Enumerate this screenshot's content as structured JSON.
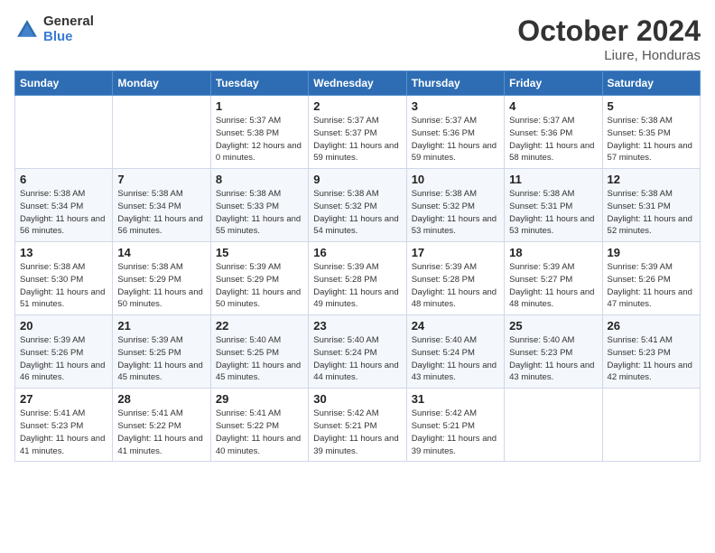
{
  "logo": {
    "general": "General",
    "blue": "Blue"
  },
  "title": "October 2024",
  "location": "Liure, Honduras",
  "headers": [
    "Sunday",
    "Monday",
    "Tuesday",
    "Wednesday",
    "Thursday",
    "Friday",
    "Saturday"
  ],
  "weeks": [
    [
      {
        "day": "",
        "sunrise": "",
        "sunset": "",
        "daylight": ""
      },
      {
        "day": "",
        "sunrise": "",
        "sunset": "",
        "daylight": ""
      },
      {
        "day": "1",
        "sunrise": "Sunrise: 5:37 AM",
        "sunset": "Sunset: 5:38 PM",
        "daylight": "Daylight: 12 hours and 0 minutes."
      },
      {
        "day": "2",
        "sunrise": "Sunrise: 5:37 AM",
        "sunset": "Sunset: 5:37 PM",
        "daylight": "Daylight: 11 hours and 59 minutes."
      },
      {
        "day": "3",
        "sunrise": "Sunrise: 5:37 AM",
        "sunset": "Sunset: 5:36 PM",
        "daylight": "Daylight: 11 hours and 59 minutes."
      },
      {
        "day": "4",
        "sunrise": "Sunrise: 5:37 AM",
        "sunset": "Sunset: 5:36 PM",
        "daylight": "Daylight: 11 hours and 58 minutes."
      },
      {
        "day": "5",
        "sunrise": "Sunrise: 5:38 AM",
        "sunset": "Sunset: 5:35 PM",
        "daylight": "Daylight: 11 hours and 57 minutes."
      }
    ],
    [
      {
        "day": "6",
        "sunrise": "Sunrise: 5:38 AM",
        "sunset": "Sunset: 5:34 PM",
        "daylight": "Daylight: 11 hours and 56 minutes."
      },
      {
        "day": "7",
        "sunrise": "Sunrise: 5:38 AM",
        "sunset": "Sunset: 5:34 PM",
        "daylight": "Daylight: 11 hours and 56 minutes."
      },
      {
        "day": "8",
        "sunrise": "Sunrise: 5:38 AM",
        "sunset": "Sunset: 5:33 PM",
        "daylight": "Daylight: 11 hours and 55 minutes."
      },
      {
        "day": "9",
        "sunrise": "Sunrise: 5:38 AM",
        "sunset": "Sunset: 5:32 PM",
        "daylight": "Daylight: 11 hours and 54 minutes."
      },
      {
        "day": "10",
        "sunrise": "Sunrise: 5:38 AM",
        "sunset": "Sunset: 5:32 PM",
        "daylight": "Daylight: 11 hours and 53 minutes."
      },
      {
        "day": "11",
        "sunrise": "Sunrise: 5:38 AM",
        "sunset": "Sunset: 5:31 PM",
        "daylight": "Daylight: 11 hours and 53 minutes."
      },
      {
        "day": "12",
        "sunrise": "Sunrise: 5:38 AM",
        "sunset": "Sunset: 5:31 PM",
        "daylight": "Daylight: 11 hours and 52 minutes."
      }
    ],
    [
      {
        "day": "13",
        "sunrise": "Sunrise: 5:38 AM",
        "sunset": "Sunset: 5:30 PM",
        "daylight": "Daylight: 11 hours and 51 minutes."
      },
      {
        "day": "14",
        "sunrise": "Sunrise: 5:38 AM",
        "sunset": "Sunset: 5:29 PM",
        "daylight": "Daylight: 11 hours and 50 minutes."
      },
      {
        "day": "15",
        "sunrise": "Sunrise: 5:39 AM",
        "sunset": "Sunset: 5:29 PM",
        "daylight": "Daylight: 11 hours and 50 minutes."
      },
      {
        "day": "16",
        "sunrise": "Sunrise: 5:39 AM",
        "sunset": "Sunset: 5:28 PM",
        "daylight": "Daylight: 11 hours and 49 minutes."
      },
      {
        "day": "17",
        "sunrise": "Sunrise: 5:39 AM",
        "sunset": "Sunset: 5:28 PM",
        "daylight": "Daylight: 11 hours and 48 minutes."
      },
      {
        "day": "18",
        "sunrise": "Sunrise: 5:39 AM",
        "sunset": "Sunset: 5:27 PM",
        "daylight": "Daylight: 11 hours and 48 minutes."
      },
      {
        "day": "19",
        "sunrise": "Sunrise: 5:39 AM",
        "sunset": "Sunset: 5:26 PM",
        "daylight": "Daylight: 11 hours and 47 minutes."
      }
    ],
    [
      {
        "day": "20",
        "sunrise": "Sunrise: 5:39 AM",
        "sunset": "Sunset: 5:26 PM",
        "daylight": "Daylight: 11 hours and 46 minutes."
      },
      {
        "day": "21",
        "sunrise": "Sunrise: 5:39 AM",
        "sunset": "Sunset: 5:25 PM",
        "daylight": "Daylight: 11 hours and 45 minutes."
      },
      {
        "day": "22",
        "sunrise": "Sunrise: 5:40 AM",
        "sunset": "Sunset: 5:25 PM",
        "daylight": "Daylight: 11 hours and 45 minutes."
      },
      {
        "day": "23",
        "sunrise": "Sunrise: 5:40 AM",
        "sunset": "Sunset: 5:24 PM",
        "daylight": "Daylight: 11 hours and 44 minutes."
      },
      {
        "day": "24",
        "sunrise": "Sunrise: 5:40 AM",
        "sunset": "Sunset: 5:24 PM",
        "daylight": "Daylight: 11 hours and 43 minutes."
      },
      {
        "day": "25",
        "sunrise": "Sunrise: 5:40 AM",
        "sunset": "Sunset: 5:23 PM",
        "daylight": "Daylight: 11 hours and 43 minutes."
      },
      {
        "day": "26",
        "sunrise": "Sunrise: 5:41 AM",
        "sunset": "Sunset: 5:23 PM",
        "daylight": "Daylight: 11 hours and 42 minutes."
      }
    ],
    [
      {
        "day": "27",
        "sunrise": "Sunrise: 5:41 AM",
        "sunset": "Sunset: 5:23 PM",
        "daylight": "Daylight: 11 hours and 41 minutes."
      },
      {
        "day": "28",
        "sunrise": "Sunrise: 5:41 AM",
        "sunset": "Sunset: 5:22 PM",
        "daylight": "Daylight: 11 hours and 41 minutes."
      },
      {
        "day": "29",
        "sunrise": "Sunrise: 5:41 AM",
        "sunset": "Sunset: 5:22 PM",
        "daylight": "Daylight: 11 hours and 40 minutes."
      },
      {
        "day": "30",
        "sunrise": "Sunrise: 5:42 AM",
        "sunset": "Sunset: 5:21 PM",
        "daylight": "Daylight: 11 hours and 39 minutes."
      },
      {
        "day": "31",
        "sunrise": "Sunrise: 5:42 AM",
        "sunset": "Sunset: 5:21 PM",
        "daylight": "Daylight: 11 hours and 39 minutes."
      },
      {
        "day": "",
        "sunrise": "",
        "sunset": "",
        "daylight": ""
      },
      {
        "day": "",
        "sunrise": "",
        "sunset": "",
        "daylight": ""
      }
    ]
  ]
}
